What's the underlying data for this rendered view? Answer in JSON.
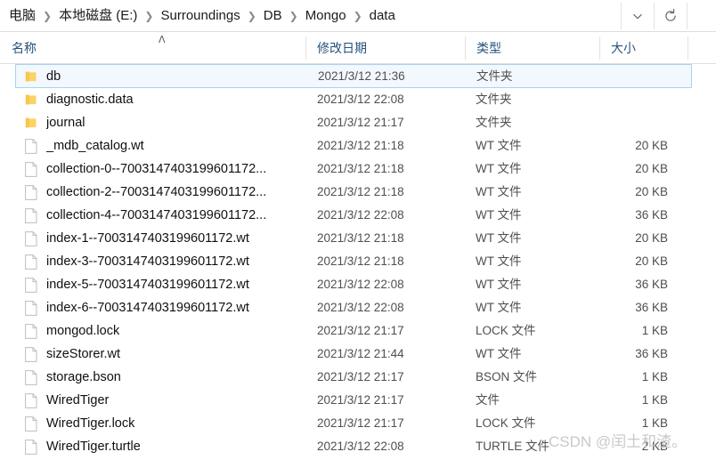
{
  "address_bar": {
    "breadcrumbs": [
      {
        "label": "电脑"
      },
      {
        "label": "本地磁盘 (E:)"
      },
      {
        "label": "Surroundings"
      },
      {
        "label": "DB"
      },
      {
        "label": "Mongo"
      },
      {
        "label": "data"
      }
    ],
    "separator": "❯",
    "dropdown_icon": "chevron-down-icon",
    "refresh_icon": "refresh-icon"
  },
  "columns": [
    {
      "key": "name",
      "label": "名称",
      "sorted": "asc",
      "sort_caret": "ᐱ"
    },
    {
      "key": "date",
      "label": "修改日期"
    },
    {
      "key": "type",
      "label": "类型"
    },
    {
      "key": "size",
      "label": "大小"
    }
  ],
  "files": [
    {
      "name": "db",
      "date": "2021/3/12 21:36",
      "type": "文件夹",
      "size": "",
      "icon": "folder-icon",
      "selected": true
    },
    {
      "name": "diagnostic.data",
      "date": "2021/3/12 22:08",
      "type": "文件夹",
      "size": "",
      "icon": "folder-icon",
      "selected": false
    },
    {
      "name": "journal",
      "date": "2021/3/12 21:17",
      "type": "文件夹",
      "size": "",
      "icon": "folder-icon",
      "selected": false
    },
    {
      "name": "_mdb_catalog.wt",
      "date": "2021/3/12 21:18",
      "type": "WT 文件",
      "size": "20 KB",
      "icon": "file-icon",
      "selected": false
    },
    {
      "name": "collection-0--7003147403199601172...",
      "date": "2021/3/12 21:18",
      "type": "WT 文件",
      "size": "20 KB",
      "icon": "file-icon",
      "selected": false
    },
    {
      "name": "collection-2--7003147403199601172...",
      "date": "2021/3/12 21:18",
      "type": "WT 文件",
      "size": "20 KB",
      "icon": "file-icon",
      "selected": false
    },
    {
      "name": "collection-4--7003147403199601172...",
      "date": "2021/3/12 22:08",
      "type": "WT 文件",
      "size": "36 KB",
      "icon": "file-icon",
      "selected": false
    },
    {
      "name": "index-1--7003147403199601172.wt",
      "date": "2021/3/12 21:18",
      "type": "WT 文件",
      "size": "20 KB",
      "icon": "file-icon",
      "selected": false
    },
    {
      "name": "index-3--7003147403199601172.wt",
      "date": "2021/3/12 21:18",
      "type": "WT 文件",
      "size": "20 KB",
      "icon": "file-icon",
      "selected": false
    },
    {
      "name": "index-5--7003147403199601172.wt",
      "date": "2021/3/12 22:08",
      "type": "WT 文件",
      "size": "36 KB",
      "icon": "file-icon",
      "selected": false
    },
    {
      "name": "index-6--7003147403199601172.wt",
      "date": "2021/3/12 22:08",
      "type": "WT 文件",
      "size": "36 KB",
      "icon": "file-icon",
      "selected": false
    },
    {
      "name": "mongod.lock",
      "date": "2021/3/12 21:17",
      "type": "LOCK 文件",
      "size": "1 KB",
      "icon": "file-icon",
      "selected": false
    },
    {
      "name": "sizeStorer.wt",
      "date": "2021/3/12 21:44",
      "type": "WT 文件",
      "size": "36 KB",
      "icon": "file-icon",
      "selected": false
    },
    {
      "name": "storage.bson",
      "date": "2021/3/12 21:17",
      "type": "BSON 文件",
      "size": "1 KB",
      "icon": "file-icon",
      "selected": false
    },
    {
      "name": "WiredTiger",
      "date": "2021/3/12 21:17",
      "type": "文件",
      "size": "1 KB",
      "icon": "file-icon",
      "selected": false
    },
    {
      "name": "WiredTiger.lock",
      "date": "2021/3/12 21:17",
      "type": "LOCK 文件",
      "size": "1 KB",
      "icon": "file-icon",
      "selected": false
    },
    {
      "name": "WiredTiger.turtle",
      "date": "2021/3/12 22:08",
      "type": "TURTLE 文件",
      "size": "2 KB",
      "icon": "file-icon",
      "selected": false
    }
  ],
  "watermark": {
    "text": "CSDN @闰土和渣。"
  },
  "colors": {
    "folder": "#FCD264",
    "selection_bg": "#F2F8FD",
    "selection_border": "#A8D3F0",
    "header_text": "#26527D",
    "secondary_text": "#4F4F4F"
  }
}
